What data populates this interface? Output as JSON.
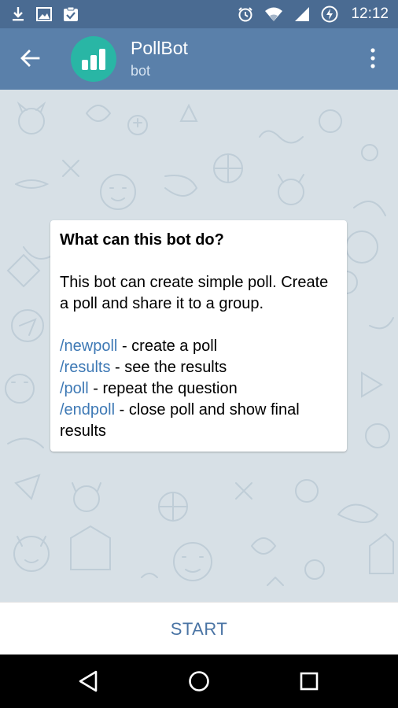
{
  "status_bar": {
    "time": "12:12",
    "left_icons": [
      "download-icon",
      "image-icon",
      "clipboard-check-icon"
    ],
    "right_icons": [
      "alarm-icon",
      "wifi-icon",
      "signal-icon",
      "battery-charging-icon"
    ]
  },
  "header": {
    "title": "PollBot",
    "subtitle": "bot",
    "avatar_color": "#29b6a5",
    "bar_color": "#5a80aa"
  },
  "info_card": {
    "title": "What can this bot do?",
    "description": "This bot can create simple poll. Create a poll and share it to a group.",
    "commands": [
      {
        "command": "/newpoll",
        "text": " - create a poll"
      },
      {
        "command": "/results",
        "text": " - see the results"
      },
      {
        "command": "/poll",
        "text": " - repeat the question"
      },
      {
        "command": "/endpoll",
        "text": " - close poll and show final results"
      }
    ]
  },
  "start_button": {
    "label": "START"
  },
  "nav_bar": {
    "icons": [
      "back-triangle-icon",
      "home-circle-icon",
      "recents-square-icon"
    ]
  }
}
